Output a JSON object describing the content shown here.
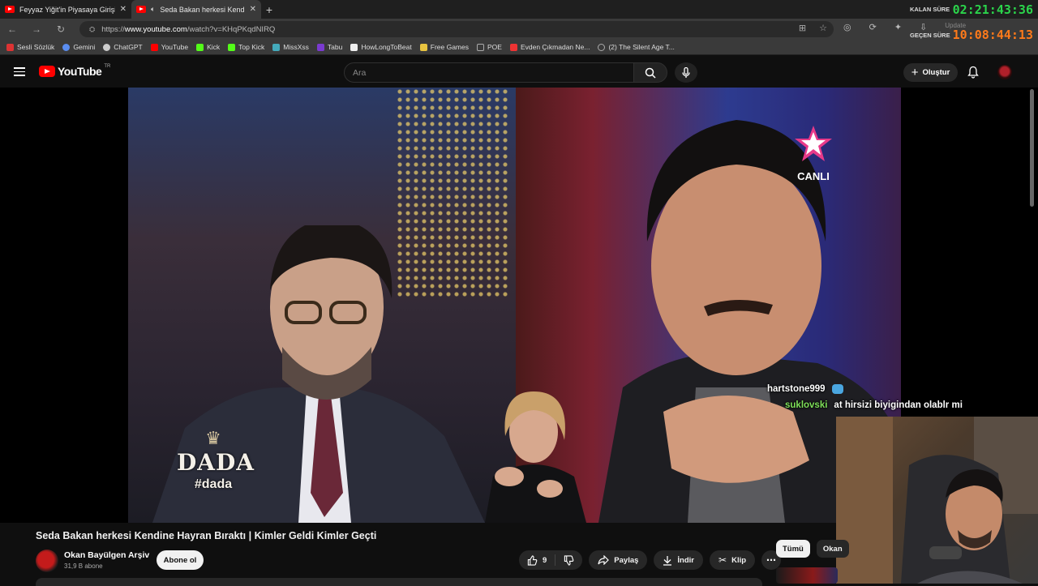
{
  "browser": {
    "tabs": [
      {
        "title": "Feyyaz Yiğit'in Piyasaya Girişi! | Fe",
        "active": false
      },
      {
        "title": "Seda Bakan herkesi Kendine",
        "active": true
      }
    ],
    "url_prefix": "https://",
    "url_domain": "www.youtube.com",
    "url_path": "/watch?v=KHqPKqdNIRQ",
    "update_label": "Update",
    "bookmarks": [
      {
        "label": "Sesli Sözlük",
        "color": "#d33"
      },
      {
        "label": "Gemini",
        "color": "#5a8df0"
      },
      {
        "label": "ChatGPT",
        "color": "#ccc"
      },
      {
        "label": "YouTube",
        "color": "#f00"
      },
      {
        "label": "Kick",
        "color": "#53fc18"
      },
      {
        "label": "Top Kick",
        "color": "#53fc18"
      },
      {
        "label": "MissXss",
        "color": "#4ab"
      },
      {
        "label": "Tabu",
        "color": "#7a3ad0"
      },
      {
        "label": "HowLongToBeat",
        "color": "#eee"
      },
      {
        "label": "Free Games",
        "color": "#e8c440"
      },
      {
        "label": "POE",
        "color": "#aaa"
      },
      {
        "label": "Evden Çıkmadan Ne...",
        "color": "#e33"
      },
      {
        "label": "(2) The Silent Age T...",
        "color": "#aaa"
      }
    ]
  },
  "timer": {
    "remaining_label": "KALAN SÜRE",
    "remaining_value": "02:21:43:36",
    "elapsed_label": "GEÇEN SÜRE",
    "elapsed_value": "10:08:44:13",
    "remaining_color": "#2bd44b",
    "elapsed_color": "#ff7a1a"
  },
  "youtube": {
    "logo_text": "YouTube",
    "logo_region": "TR",
    "search_placeholder": "Ara",
    "create_label": "Oluştur"
  },
  "video": {
    "overlay_logo": "DADA",
    "overlay_hashtag": "#dada",
    "channel_live": "CANLI"
  },
  "chat": [
    {
      "user": "hartstone999",
      "message": ""
    },
    {
      "user": "suklovski",
      "message": "at hirsizi biyigindan olablr mi"
    }
  ],
  "info": {
    "title": "Seda Bakan herkesi Kendine Hayran Bıraktı | Kimler Geldi Kimler Geçti",
    "channel": "Okan Bayülgen Arşiv",
    "subscribers": "31,9 B abone",
    "subscribe_label": "Abone ol",
    "like_count": "9",
    "share_label": "Paylaş",
    "download_label": "İndir",
    "clip_label": "Klip"
  },
  "chips": [
    "Tümü",
    "Okan"
  ]
}
